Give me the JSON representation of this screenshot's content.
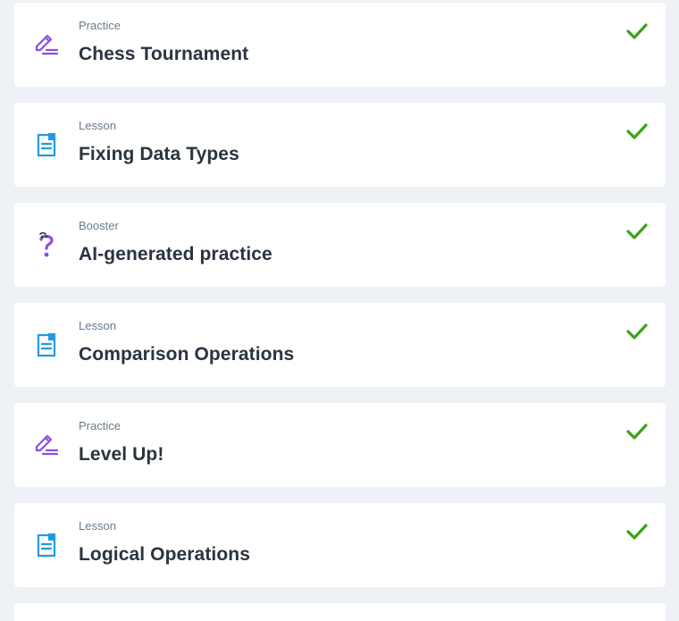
{
  "items": [
    {
      "type": "Practice",
      "title": "Chess Tournament",
      "icon": "pencil-icon"
    },
    {
      "type": "Lesson",
      "title": "Fixing Data Types",
      "icon": "document-icon"
    },
    {
      "type": "Booster",
      "title": "AI-generated practice",
      "icon": "question-icon"
    },
    {
      "type": "Lesson",
      "title": "Comparison Operations",
      "icon": "document-icon"
    },
    {
      "type": "Practice",
      "title": "Level Up!",
      "icon": "pencil-icon"
    },
    {
      "type": "Lesson",
      "title": "Logical Operations",
      "icon": "document-icon"
    }
  ],
  "colors": {
    "background": "#eef2f6",
    "card": "#ffffff",
    "practice_icon": "#8a4fe0",
    "lesson_icon": "#1f9be6",
    "booster_icon": "#8a4fe0",
    "check": "#3aa317",
    "type_text": "#6b7a8c",
    "title_text": "#2a3340"
  }
}
